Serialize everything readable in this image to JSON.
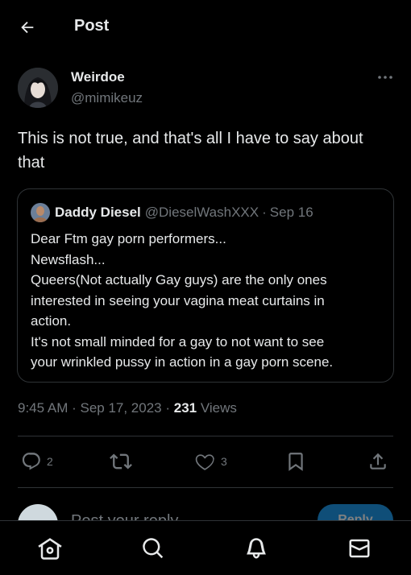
{
  "header": {
    "title": "Post",
    "back_icon": "arrow-left-icon"
  },
  "post": {
    "author_name": "Weirdoe",
    "author_handle": "@mimikeuz",
    "text": "This is not true, and that's all I have to say about that",
    "timestamp": "9:45 AM · Sep 17, 2023",
    "separator": "·",
    "views_count": "231",
    "views_label": "Views"
  },
  "quote": {
    "author_name": "Daddy Diesel",
    "author_handle": "@DieselWashXXX",
    "separator": "·",
    "date": "Sep 16",
    "lines": [
      "Dear Ftm gay porn performers...",
      "Newsflash...",
      "Queers(Not actually Gay guys) are the only ones",
      "interested in seeing your vagina meat curtains in",
      "action.",
      "It's not small minded for a gay to not want to see",
      "your wrinkled pussy in action in a gay porn scene."
    ]
  },
  "actions": {
    "reply_count": "2",
    "repost_count": "",
    "like_count": "3"
  },
  "reply_box": {
    "placeholder": "Post your reply",
    "button_label": "Reply"
  },
  "nav": {
    "items": [
      "home-icon",
      "search-icon",
      "notifications-icon",
      "messages-icon"
    ]
  },
  "colors": {
    "background": "#000000",
    "text": "#e7e9ea",
    "secondary": "#71767b",
    "border": "#2f3336"
  }
}
